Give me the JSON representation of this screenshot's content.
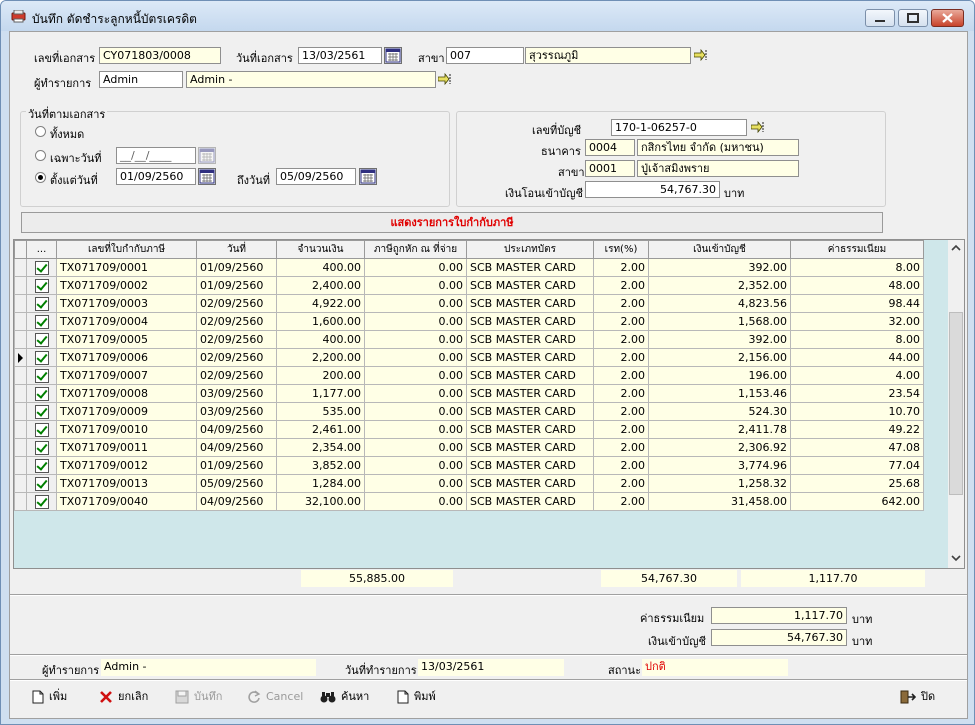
{
  "window": {
    "title": "บันทึก ตัดชำระลูกหนี้บัตรเครดิต"
  },
  "header": {
    "doc_no_label": "เลขที่เอกสาร",
    "doc_no": "CY071803/0008",
    "doc_date_label": "วันที่เอกสาร",
    "doc_date": "13/03/2561",
    "branch_label": "สาขา",
    "branch_code": "007",
    "branch_name": "สุวรรณภูมิ",
    "maker_label": "ผู้ทำรายการ",
    "maker_code": "Admin",
    "maker_name": "Admin -"
  },
  "date_filter": {
    "group_label": "วันที่ตามเอกสาร",
    "all_label": "ทั้งหมด",
    "specific_label": "เฉพาะวันที่",
    "specific_value": "__/__/____",
    "from_label": "ตั้งแต่วันที่",
    "from_value": "01/09/2560",
    "to_label": "ถึงวันที่",
    "to_value": "05/09/2560"
  },
  "bank": {
    "account_label": "เลขที่บัญชี",
    "account_no": "170-1-06257-0",
    "bank_label": "ธนาคาร",
    "bank_code": "0004",
    "bank_name": "กสิกรไทย จำกัด (มหาชน)",
    "branch_label": "สาขา",
    "branch_code": "0001",
    "branch_name": "ปู่เจ้าสมิงพราย",
    "transfer_label": "เงินโอนเข้าบัญชี",
    "transfer_amount": "54,767.30",
    "baht": "บาท"
  },
  "banner": "แสดงรายการใบกำกับภาษี",
  "grid": {
    "headers": [
      "...",
      "เลขที่ใบกำกับภาษี",
      "วันที่",
      "จำนวนเงิน",
      "ภาษีถูกหัก ณ ที่จ่าย",
      "ประเภทบัตร",
      "เรท(%)",
      "เงินเข้าบัญชี",
      "ค่าธรรมเนียม"
    ],
    "rows": [
      [
        "TX071709/0001",
        "01/09/2560",
        "400.00",
        "0.00",
        "SCB MASTER CARD",
        "2.00",
        "392.00",
        "8.00"
      ],
      [
        "TX071709/0002",
        "01/09/2560",
        "2,400.00",
        "0.00",
        "SCB MASTER CARD",
        "2.00",
        "2,352.00",
        "48.00"
      ],
      [
        "TX071709/0003",
        "02/09/2560",
        "4,922.00",
        "0.00",
        "SCB MASTER CARD",
        "2.00",
        "4,823.56",
        "98.44"
      ],
      [
        "TX071709/0004",
        "02/09/2560",
        "1,600.00",
        "0.00",
        "SCB MASTER CARD",
        "2.00",
        "1,568.00",
        "32.00"
      ],
      [
        "TX071709/0005",
        "02/09/2560",
        "400.00",
        "0.00",
        "SCB MASTER CARD",
        "2.00",
        "392.00",
        "8.00"
      ],
      [
        "TX071709/0006",
        "02/09/2560",
        "2,200.00",
        "0.00",
        "SCB MASTER CARD",
        "2.00",
        "2,156.00",
        "44.00"
      ],
      [
        "TX071709/0007",
        "02/09/2560",
        "200.00",
        "0.00",
        "SCB MASTER CARD",
        "2.00",
        "196.00",
        "4.00"
      ],
      [
        "TX071709/0008",
        "03/09/2560",
        "1,177.00",
        "0.00",
        "SCB MASTER CARD",
        "2.00",
        "1,153.46",
        "23.54"
      ],
      [
        "TX071709/0009",
        "03/09/2560",
        "535.00",
        "0.00",
        "SCB MASTER CARD",
        "2.00",
        "524.30",
        "10.70"
      ],
      [
        "TX071709/0010",
        "04/09/2560",
        "2,461.00",
        "0.00",
        "SCB MASTER CARD",
        "2.00",
        "2,411.78",
        "49.22"
      ],
      [
        "TX071709/0011",
        "04/09/2560",
        "2,354.00",
        "0.00",
        "SCB MASTER CARD",
        "2.00",
        "2,306.92",
        "47.08"
      ],
      [
        "TX071709/0012",
        "01/09/2560",
        "3,852.00",
        "0.00",
        "SCB MASTER CARD",
        "2.00",
        "3,774.96",
        "77.04"
      ],
      [
        "TX071709/0013",
        "05/09/2560",
        "1,284.00",
        "0.00",
        "SCB MASTER CARD",
        "2.00",
        "1,258.32",
        "25.68"
      ],
      [
        "TX071709/0040",
        "04/09/2560",
        "32,100.00",
        "0.00",
        "SCB MASTER CARD",
        "2.00",
        "31,458.00",
        "642.00"
      ]
    ],
    "selected_row": 5,
    "totals": {
      "amount": "55,885.00",
      "to_account": "54,767.30",
      "fee": "1,117.70"
    }
  },
  "summary": {
    "fee_label": "ค่าธรรมเนียม",
    "fee": "1,117.70",
    "to_account_label": "เงินเข้าบัญชี",
    "to_account": "54,767.30",
    "baht": "บาท"
  },
  "status": {
    "maker_label": "ผู้ทำรายการ",
    "maker": "Admin -",
    "date_label": "วันที่ทำรายการ",
    "date": "13/03/2561",
    "state_label": "สถานะ",
    "state": "ปกติ"
  },
  "toolbar": {
    "add": "เพิ่ม",
    "cancel_doc": "ยกเลิก",
    "save": "บันทึก",
    "cancel": "Cancel",
    "search": "ค้นหา",
    "print": "พิมพ์",
    "close": "ปิด"
  }
}
